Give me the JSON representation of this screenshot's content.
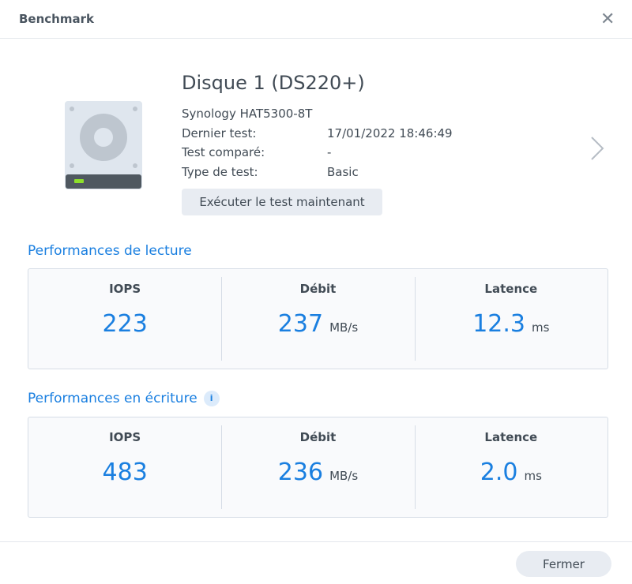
{
  "dialog": {
    "title": "Benchmark",
    "close_icon": "close-icon"
  },
  "disk": {
    "name": "Disque 1 (DS220+)",
    "model": "Synology HAT5300-8T",
    "rows": [
      {
        "label": "Dernier test:",
        "value": "17/01/2022 18:46:49"
      },
      {
        "label": "Test comparé:",
        "value": "-"
      },
      {
        "label": "Type de test:",
        "value": "Basic"
      }
    ],
    "run_button": "Exécuter le test maintenant"
  },
  "read": {
    "heading": "Performances de lecture",
    "metrics": [
      {
        "label": "IOPS",
        "value": "223",
        "unit": ""
      },
      {
        "label": "Débit",
        "value": "237",
        "unit": "MB/s"
      },
      {
        "label": "Latence",
        "value": "12.3",
        "unit": "ms"
      }
    ]
  },
  "write": {
    "heading": "Performances en écriture",
    "info_icon": "i",
    "metrics": [
      {
        "label": "IOPS",
        "value": "483",
        "unit": ""
      },
      {
        "label": "Débit",
        "value": "236",
        "unit": "MB/s"
      },
      {
        "label": "Latence",
        "value": "2.0",
        "unit": "ms"
      }
    ]
  },
  "footer": {
    "close_button": "Fermer"
  },
  "colors": {
    "accent": "#1a7fe0",
    "led": "#8de02a"
  }
}
